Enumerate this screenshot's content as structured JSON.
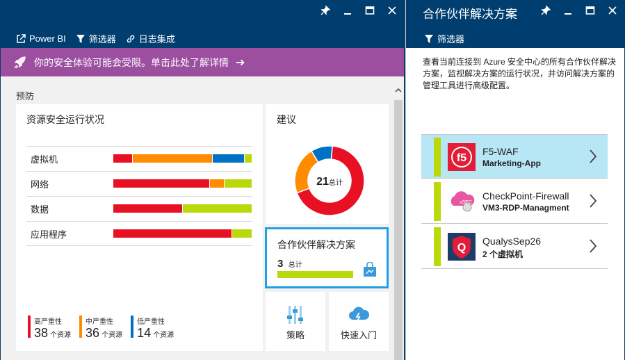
{
  "left_blade": {
    "command_bar": {
      "powerbi": "Power BI",
      "filter": "筛选器",
      "log": "日志集成"
    },
    "banner": {
      "text": "你的安全体验可能会受限。单击此处了解详情"
    },
    "section_label": "预防",
    "resource_health": {
      "title": "资源安全运行状况",
      "rows": [
        {
          "label": "虚拟机",
          "segments": [
            {
              "color": "#e81123",
              "pct": 14
            },
            {
              "color": "#ff8c00",
              "pct": 58
            },
            {
              "color": "#0072c6",
              "pct": 23
            },
            {
              "color": "#bad80a",
              "pct": 5
            }
          ]
        },
        {
          "label": "网络",
          "segments": [
            {
              "color": "#e81123",
              "pct": 70
            },
            {
              "color": "#ff8c00",
              "pct": 10
            },
            {
              "color": "#bad80a",
              "pct": 20
            }
          ]
        },
        {
          "label": "数据",
          "segments": [
            {
              "color": "#e81123",
              "pct": 50
            },
            {
              "color": "#bad80a",
              "pct": 50
            }
          ]
        },
        {
          "label": "应用程序",
          "segments": [
            {
              "color": "#e81123",
              "pct": 86
            },
            {
              "color": "#bad80a",
              "pct": 14
            }
          ]
        }
      ],
      "legend": [
        {
          "name": "高严重性",
          "num": "38",
          "unit": "个资源",
          "color": "#e81123"
        },
        {
          "name": "中严重性",
          "num": "36",
          "unit": "个资源",
          "color": "#ff8c00"
        },
        {
          "name": "低严重性",
          "num": "14",
          "unit": "个资源",
          "color": "#0072c6"
        }
      ]
    },
    "recommendations": {
      "title": "建议",
      "total": "21",
      "total_label": "总计",
      "segments": [
        {
          "color": "#e81123",
          "value": 68
        },
        {
          "color": "#ff8c00",
          "value": 22
        },
        {
          "color": "#0072c6",
          "value": 10
        }
      ]
    },
    "partner_tile": {
      "title": "合作伙伴解决方案",
      "count": "3",
      "count_label": "总计"
    },
    "policy_tile": {
      "label": "策略"
    },
    "quickstart_tile": {
      "label": "快速入门"
    }
  },
  "right_blade": {
    "title": "合作伙伴解决方案",
    "filter": "筛选器",
    "description": "查看当前连接到 Azure 安全中心的所有合作伙伴解决方案，监视解决方案的运行状况，并访问解决方案的管理工具进行高级配置。",
    "partners": [
      {
        "name": "F5-WAF",
        "sub": "Marketing-App",
        "logo": "f5-logo-icon",
        "selected": true
      },
      {
        "name": "CheckPoint-Firewall",
        "sub": "VM3-RDP-Managment",
        "logo": "checkpoint-logo-icon",
        "selected": false
      },
      {
        "name": "QualysSep26",
        "sub": "2 个虚拟机",
        "logo": "qualys-logo-icon",
        "selected": false
      }
    ]
  },
  "colors": {
    "header": "#003e70",
    "banner": "#9c4f9f",
    "accent_green": "#bad80a",
    "selected": "#b7e6f5",
    "tile_border": "#1ea0e3"
  }
}
